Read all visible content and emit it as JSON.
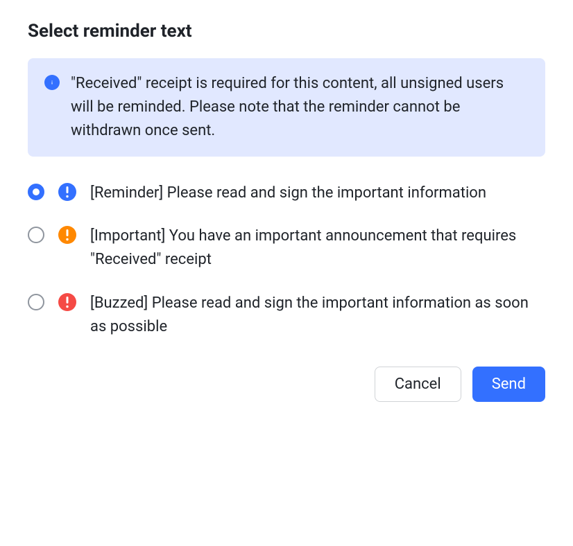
{
  "title": "Select reminder text",
  "info": {
    "text": "\"Received\" receipt is required for this content, all unsigned users will be reminded. Please note that the reminder cannot be withdrawn once sent."
  },
  "options": [
    {
      "selected": true,
      "badge_color": "blue",
      "label": "[Reminder] Please read and sign the important information"
    },
    {
      "selected": false,
      "badge_color": "orange",
      "label": "[Important] You have an important announcement that requires \"Received\" receipt"
    },
    {
      "selected": false,
      "badge_color": "red",
      "label": "[Buzzed] Please read and sign the important information as soon as possible"
    }
  ],
  "buttons": {
    "cancel": "Cancel",
    "send": "Send"
  }
}
